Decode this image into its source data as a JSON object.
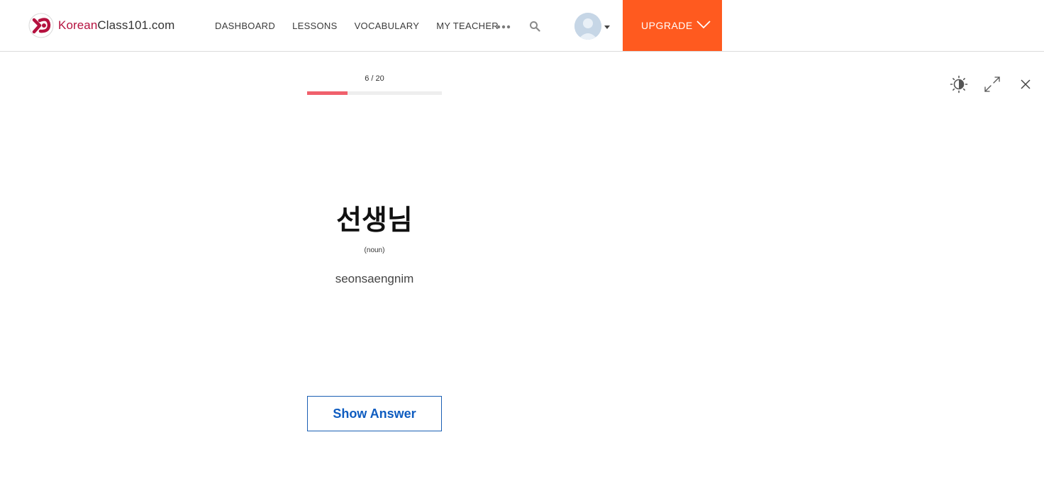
{
  "header": {
    "logo_brand": "Korean",
    "logo_rest": "Class101.com",
    "nav_items": [
      {
        "label": "DASHBOARD"
      },
      {
        "label": "LESSONS"
      },
      {
        "label": "VOCABULARY"
      },
      {
        "label": "MY TEACHER"
      }
    ],
    "more_icon": "ellipsis-icon",
    "search_icon": "search-icon",
    "upgrade_label": "UPGRADE"
  },
  "flashcard": {
    "progress_text": "6 / 20",
    "progress_current": 6,
    "progress_total": 20,
    "progress_fraction": 0.3,
    "word": "선생님",
    "part_of_speech": "(noun)",
    "romanization": "seonsaengnim",
    "show_answer_label": "Show Answer"
  },
  "tools": {
    "contrast_icon": "brightness-contrast-icon",
    "expand_icon": "fullscreen-expand-icon",
    "close_icon": "close-icon"
  },
  "colors": {
    "brand": "#b5123f",
    "upgrade_bg": "#ff5a1f",
    "progress_fill": "#f0606c",
    "button_blue": "#0e5cc0"
  }
}
